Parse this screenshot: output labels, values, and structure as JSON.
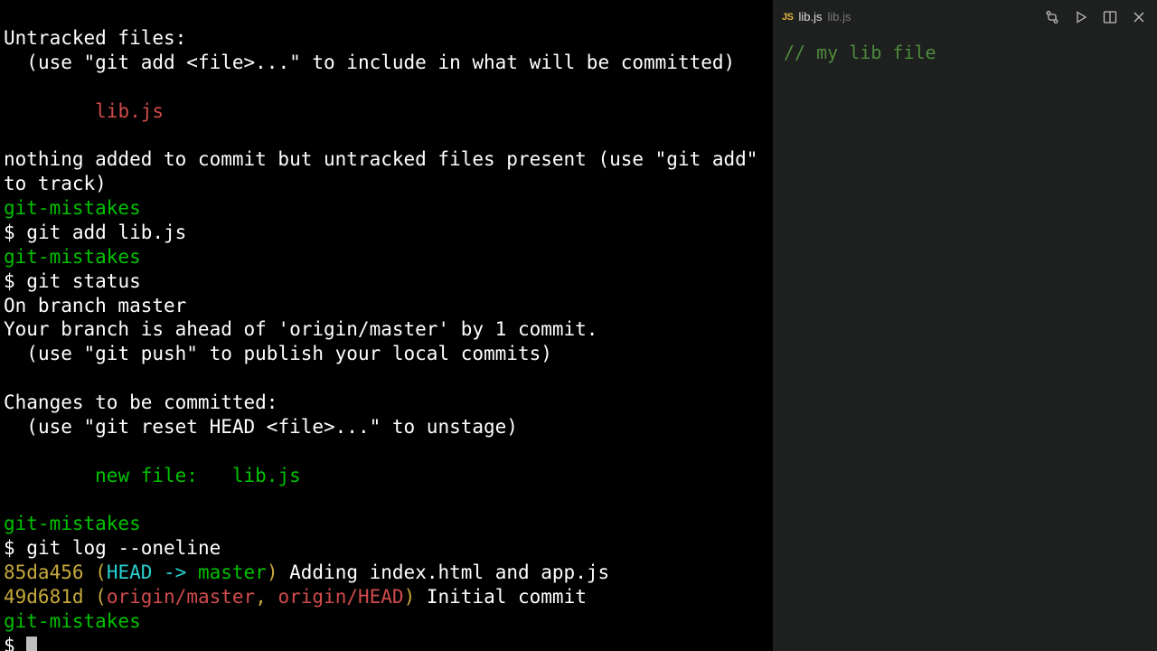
{
  "terminal": {
    "untracked_header": "Untracked files:",
    "untracked_hint": "  (use \"git add <file>...\" to include in what will be committed)",
    "untracked_file": "        lib.js",
    "nothing_added": "nothing added to commit but untracked files present (use \"git add\" to track)",
    "repo": "git-mistakes",
    "prompt": "$ ",
    "cmd_add": "git add lib.js",
    "cmd_status": "git status",
    "status_branch": "On branch master",
    "status_ahead": "Your branch is ahead of 'origin/master' by 1 commit.",
    "status_push_hint": "  (use \"git push\" to publish your local commits)",
    "changes_header": "Changes to be committed:",
    "changes_hint": "  (use \"git reset HEAD <file>...\" to unstage)",
    "new_file": "        new file:   lib.js",
    "cmd_log": "git log --oneline",
    "log1_hash": "85da456",
    "log1_paren_open": " (",
    "log1_head": "HEAD -> ",
    "log1_master": "master",
    "log1_paren_close": ")",
    "log1_msg": " Adding index.html and app.js",
    "log2_hash": "49d681d",
    "log2_paren_open": " (",
    "log2_remote": "origin/master",
    "log2_sep": ", ",
    "log2_head": "origin/HEAD",
    "log2_paren_close": ")",
    "log2_msg": " Initial commit"
  },
  "editor": {
    "tab": {
      "badge": "JS",
      "filename": "lib.js",
      "path": "lib.js"
    },
    "content": "// my lib file"
  }
}
